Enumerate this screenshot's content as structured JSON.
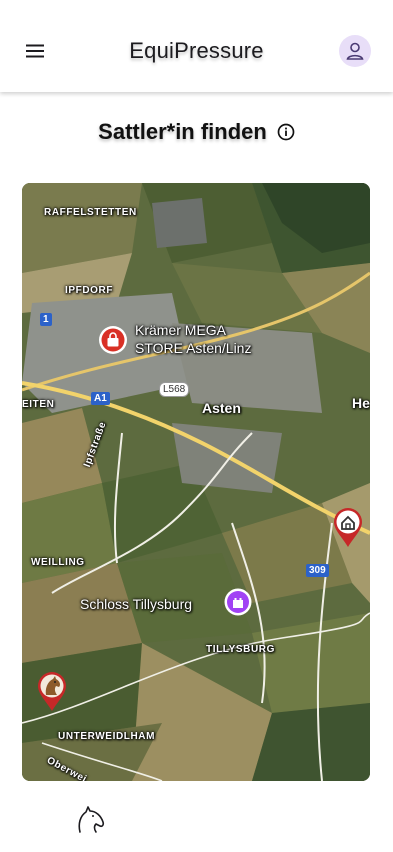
{
  "app": {
    "title": "EquiPressure"
  },
  "icons": {
    "menu": "menu-icon",
    "profile": "person-icon",
    "info": "info-icon",
    "logo": "horse-head-icon"
  },
  "page": {
    "heading": "Sattler*in finden"
  },
  "map": {
    "places": {
      "raffelstetten": "RAFFELSTETTEN",
      "ipfdorf": "IPFDORF",
      "eiten": "EITEN",
      "he": "He",
      "asten": "Asten",
      "weilling": "WEILLING",
      "tillysburg": "TILLYSBURG",
      "unterweidlham": "UNTERWEIDLHAM",
      "oberwei": "Oberwei",
      "ipfstrasse": "Ipfstraße"
    },
    "roads": {
      "b1": "1",
      "a1": "A1",
      "l568": "L568",
      "r309": "309"
    },
    "pois": {
      "kraemer_line1": "Krämer MEGA",
      "kraemer_line2": "STORE Asten/Linz",
      "schloss": "Schloss Tillysburg"
    },
    "colors": {
      "shop": "#d93025",
      "castle": "#a142f4",
      "marker_red": "#c62828"
    }
  }
}
